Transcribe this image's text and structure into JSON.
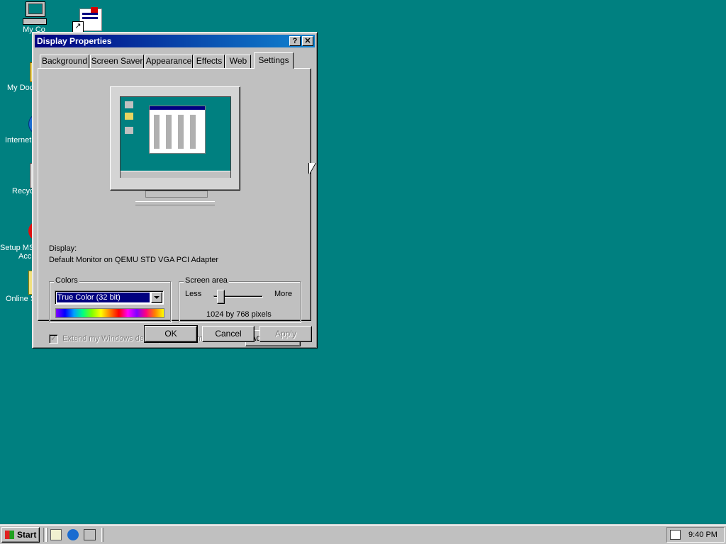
{
  "desktop": {
    "icons": [
      {
        "label": "My Co",
        "icon": "my-computer-icon"
      },
      {
        "label": "",
        "icon": "network-setup-icon"
      },
      {
        "label": "My Doc",
        "icon": "my-documents-icon"
      },
      {
        "label": "Internet",
        "icon": "internet-explorer-icon"
      },
      {
        "label": "Recyc",
        "icon": "recycle-bin-icon"
      },
      {
        "label": "Setup MS",
        "label2": "Acc",
        "icon": "msn-setup-icon"
      },
      {
        "label": "Online S",
        "icon": "online-services-folder-icon"
      }
    ]
  },
  "window": {
    "title": "Display Properties",
    "help_label": "?",
    "close_label": "✕",
    "tabs": [
      "Background",
      "Screen Saver",
      "Appearance",
      "Effects",
      "Web",
      "Settings"
    ],
    "active_tab": "Settings",
    "display_label": "Display:",
    "display_value": "Default Monitor on QEMU STD VGA PCI Adapter",
    "colors": {
      "group_label": "Colors",
      "selected": "True Color (32 bit)"
    },
    "screen_area": {
      "group_label": "Screen area",
      "less_label": "Less",
      "more_label": "More",
      "resolution": "1024 by 768 pixels",
      "slider_level": 0.08
    },
    "extend_checkbox_label": "Extend my Windows desktop onto this monitor",
    "extend_checked": true,
    "advanced_label": "Advanced...",
    "ok_label": "OK",
    "cancel_label": "Cancel",
    "apply_label": "Apply"
  },
  "taskbar": {
    "start_label": "Start",
    "clock": "9:40 PM"
  },
  "colors": {
    "desktop": "#008080",
    "title_start": "#000080",
    "title_end": "#1084d0",
    "selection": "#000080"
  }
}
